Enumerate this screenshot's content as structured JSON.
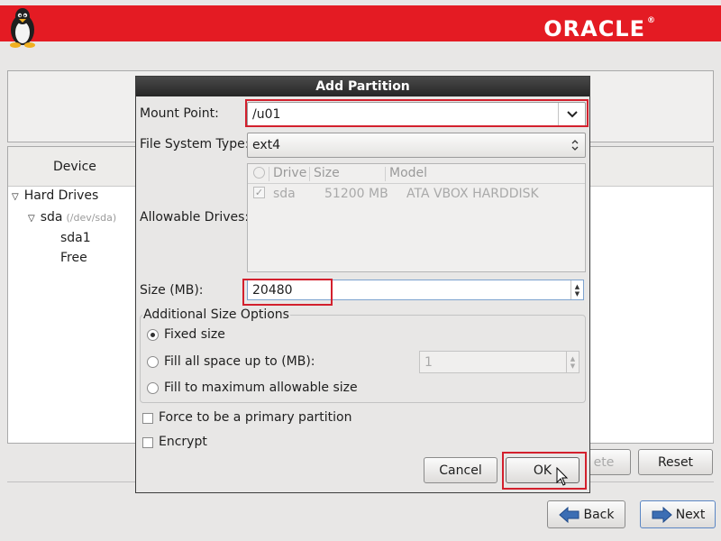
{
  "banner": {
    "brand": "ORACLE",
    "brand_mark": "®",
    "logo_icon": "tux-penguin-icon",
    "color": "#e41b23"
  },
  "device_tree": {
    "header": "Device",
    "items": [
      {
        "label": "Hard Drives",
        "expanded": true
      },
      {
        "label": "sda",
        "path": "(/dev/sda)",
        "expanded": true
      },
      {
        "label": "sda1"
      },
      {
        "label": "Free"
      }
    ]
  },
  "page_buttons": {
    "delete_partial": "ete",
    "reset": "Reset",
    "back": "Back",
    "next": "Next"
  },
  "dialog": {
    "title": "Add Partition",
    "mount_point": {
      "label": "Mount Point:",
      "value": "/u01"
    },
    "fs_type": {
      "label": "File System Type:",
      "value": "ext4"
    },
    "drives": {
      "label": "Allowable Drives:",
      "columns": [
        "Drive",
        "Size",
        "Model"
      ],
      "rows": [
        {
          "checked": true,
          "drive": "sda",
          "size": "51200 MB",
          "model": "ATA VBOX HARDDISK"
        }
      ]
    },
    "size": {
      "label": "Size (MB):",
      "value": "20480"
    },
    "size_options": {
      "title": "Additional Size Options",
      "fixed": "Fixed size",
      "fill_up_to": "Fill all space up to (MB):",
      "fill_up_to_value": "1",
      "fill_max": "Fill to maximum allowable size",
      "selected": "fixed"
    },
    "primary": {
      "label": "Force to be a primary partition",
      "checked": false
    },
    "encrypt": {
      "label": "Encrypt",
      "checked": false
    },
    "cancel": "Cancel",
    "ok": "OK"
  },
  "highlight_color": "#d3202d"
}
